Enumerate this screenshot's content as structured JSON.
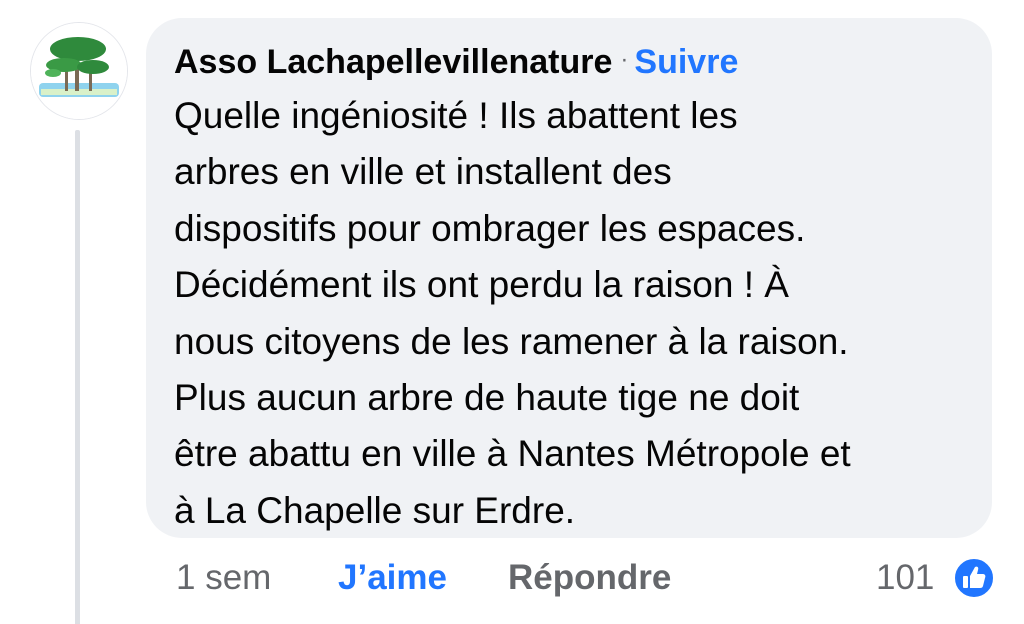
{
  "comment": {
    "author": "Asso Lachapellevillenature",
    "separator": "·",
    "follow_label": "Suivre",
    "text_lines": [
      "Quelle ingéniosité ! Ils abattent les",
      "arbres en ville et installent des",
      "dispositifs pour ombrager les espaces.",
      "Décidément ils ont perdu la raison ! À",
      "nous citoyens de les ramener à la raison.",
      "Plus aucun arbre de haute tige ne doit",
      "être abattu en ville à Nantes Métropole et",
      "à La Chapelle sur Erdre."
    ]
  },
  "actions": {
    "timestamp": "1 sem",
    "like_label": "J’aime",
    "reply_label": "Répondre",
    "reaction_count": "101",
    "reaction_icon": "like-icon"
  },
  "colors": {
    "bubble": "#f0f2f5",
    "accent": "#2176ff",
    "text": "#050505",
    "secondary": "#65676b"
  }
}
